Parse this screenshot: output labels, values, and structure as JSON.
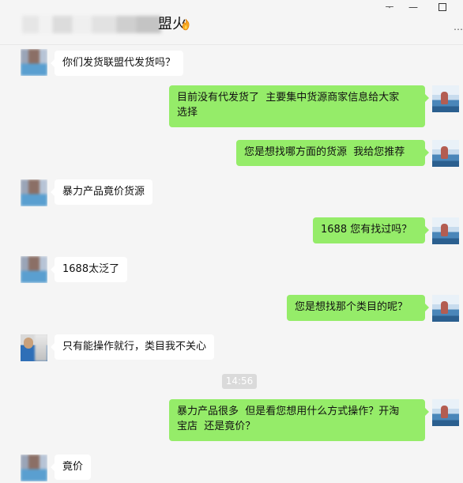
{
  "window": {
    "title_suffix": "盟火",
    "pin_glyph": "ᅮ",
    "min_glyph": "—",
    "close_glyph": "×",
    "expand_glyph": "⋯"
  },
  "messages": [
    {
      "side": "left",
      "text": "你们发货联盟代发货吗？"
    },
    {
      "side": "right",
      "text": "目前没有代发货了  主要集中货源商家信息给大家\n选择"
    },
    {
      "side": "right",
      "text": "您是想找哪方面的货源  我给您推荐"
    },
    {
      "side": "left",
      "text": "暴力产品竟价货源"
    },
    {
      "side": "right",
      "text": "1688 您有找过吗？"
    },
    {
      "side": "left",
      "text": "1688太泛了"
    },
    {
      "side": "right",
      "text": "您是想找那个类目的呢？"
    },
    {
      "side": "left",
      "text": "只有能操作就行，类目我不关心"
    },
    {
      "side": "time",
      "text": "14:56"
    },
    {
      "side": "right",
      "text": "暴力产品很多  但是看您想用什么方式操作？开淘\n宝店  还是竟价？"
    },
    {
      "side": "left",
      "text": "竟价"
    }
  ]
}
